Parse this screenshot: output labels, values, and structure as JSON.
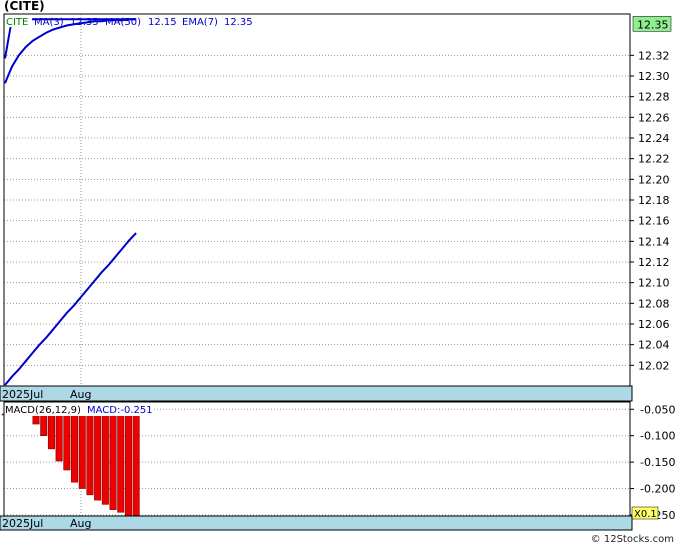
{
  "title": "(CITE)",
  "watermark": "© 12Stocks.com",
  "colors": {
    "price": "#cc0000",
    "ma": "#0000cc",
    "macd_bar": "#ee0000",
    "axis_band": "#add8e6",
    "grid": "#999999",
    "last_price_bg": "#90ee90",
    "scale_bg": "#ffff66",
    "legend_ticker": "#008000"
  },
  "legend": {
    "ticker": "CITE",
    "ma3_label": "MA(3)",
    "ma3_value": "12.35",
    "ma50_label": "MA(50)",
    "ma50_value": "12.15",
    "ema7_label": "EMA(7)",
    "ema7_value": "12.35"
  },
  "last_price": "12.35",
  "x_labels": [
    "2025Jul",
    "Aug"
  ],
  "macd_legend": {
    "label": "MACD(26,12,9)",
    "value": "MACD:-0.251"
  },
  "macd_scale": "X0.1",
  "chart_data": [
    {
      "type": "line",
      "ylim": [
        12.0,
        12.36
      ],
      "yticks": [
        12.02,
        12.04,
        12.06,
        12.08,
        12.1,
        12.12,
        12.14,
        12.16,
        12.18,
        12.2,
        12.22,
        12.24,
        12.26,
        12.28,
        12.3,
        12.32
      ],
      "yticklabels": [
        "12.02",
        "12.04",
        "12.06",
        "12.08",
        "12.10",
        "12.12",
        "12.14",
        "12.16",
        "12.18",
        "12.20",
        "12.22",
        "12.24",
        "12.26",
        "12.28",
        "12.30",
        "12.32"
      ],
      "x_sessions": 21,
      "x_category_ticks": [
        {
          "label": "2025Jul",
          "index": 0
        },
        {
          "label": "Aug",
          "index": 11
        }
      ],
      "grid": true,
      "series": [
        {
          "name": "CITE",
          "values": [
            12.355,
            12.355,
            12.355,
            12.355,
            12.355,
            12.355,
            12.355,
            12.355,
            12.355,
            12.355,
            12.355,
            12.355,
            12.355,
            12.355,
            12.355,
            12.355,
            12.355,
            12.355,
            12.355,
            12.355
          ]
        },
        {
          "name": "MA(3)",
          "values": [
            12.317,
            12.355,
            12.355,
            12.355,
            12.355,
            12.355,
            12.355,
            12.355,
            12.355,
            12.355,
            12.355,
            12.355,
            12.355,
            12.355,
            12.355,
            12.355,
            12.355,
            12.355,
            12.355,
            12.355
          ]
        },
        {
          "name": "MA(50)",
          "values": [
            12.001,
            12.009,
            12.016,
            12.024,
            12.032,
            12.04,
            12.047,
            12.055,
            12.063,
            12.071,
            12.078,
            12.086,
            12.094,
            12.102,
            12.11,
            12.117,
            12.125,
            12.133,
            12.141,
            12.148
          ]
        },
        {
          "name": "EMA(7)",
          "values": [
            12.293,
            12.309,
            12.32,
            12.328,
            12.334,
            12.338,
            12.342,
            12.345,
            12.347,
            12.349,
            12.35,
            12.351,
            12.352,
            12.353,
            12.353,
            12.354,
            12.354,
            12.354,
            12.355,
            12.355
          ]
        }
      ]
    },
    {
      "type": "bar",
      "name": "MACD(26,12,9)",
      "ylim": [
        -0.252,
        -0.04
      ],
      "yticks": [
        -0.05,
        -0.1,
        -0.15,
        -0.2,
        -0.25
      ],
      "yticklabels": [
        "-0.050",
        "-0.100",
        "-0.150",
        "-0.200",
        "-0.250"
      ],
      "series": [
        {
          "name": "MACD",
          "values": [
            -0.055,
            -0.05,
            -0.052,
            -0.062,
            -0.078,
            -0.1,
            -0.125,
            -0.148,
            -0.165,
            -0.188,
            -0.2,
            -0.212,
            -0.222,
            -0.23,
            -0.24,
            -0.245,
            -0.252,
            -0.251
          ]
        }
      ]
    }
  ]
}
